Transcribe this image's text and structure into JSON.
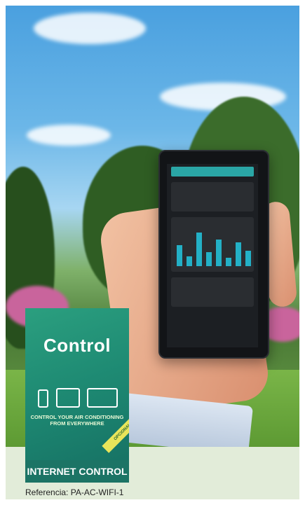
{
  "product_box": {
    "title": "Control",
    "tagline": "CONTROL YOUR AIR CONDITIONING FROM EVERYWHERE",
    "badge": "OPCIONAL",
    "footer": "INTERNET CONTROL"
  },
  "reference": "Referencia: PA-AC-WIFI-1",
  "device_icons": [
    "phone-icon",
    "tablet-icon",
    "laptop-icon"
  ],
  "colors": {
    "box_green": "#1e8a73",
    "badge_yellow": "#e9e55a",
    "page_bg": "#e2ecd9",
    "phone_accent": "#2aa6a6"
  }
}
